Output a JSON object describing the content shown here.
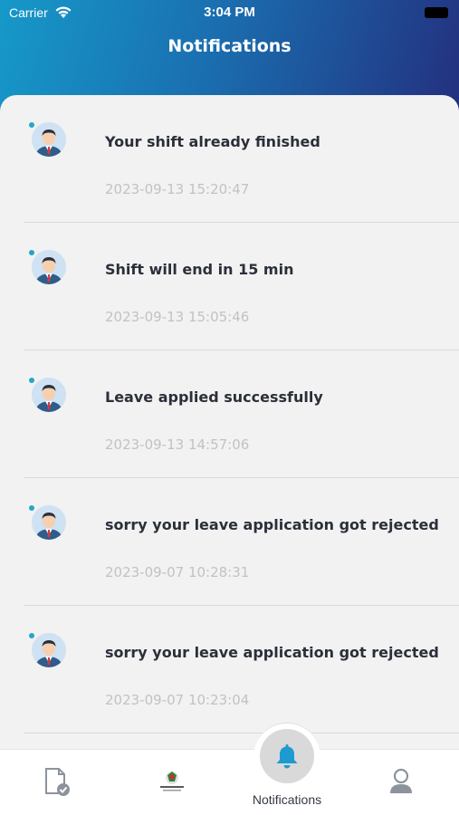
{
  "status_bar": {
    "carrier": "Carrier",
    "time": "3:04 PM"
  },
  "header": {
    "title": "Notifications"
  },
  "notifications": [
    {
      "title": "Your shift already finished",
      "time": "2023-09-13 15:20:47"
    },
    {
      "title": "Shift will end in 15 min",
      "time": "2023-09-13 15:05:46"
    },
    {
      "title": "Leave applied successfully",
      "time": "2023-09-13 14:57:06"
    },
    {
      "title": "sorry  your leave application got rejected",
      "time": "2023-09-07 10:28:31"
    },
    {
      "title": "sorry  your leave application got rejected",
      "time": "2023-09-07 10:23:04"
    }
  ],
  "tab_bar": {
    "active_label": "Notifications",
    "items": [
      "attendance-icon",
      "home-logo",
      "bell-icon",
      "profile-icon"
    ]
  },
  "colors": {
    "header_start": "#1699c9",
    "header_end": "#23307f",
    "unread_dot": "#23a6c9",
    "active_tab": "#1d9bd1"
  }
}
